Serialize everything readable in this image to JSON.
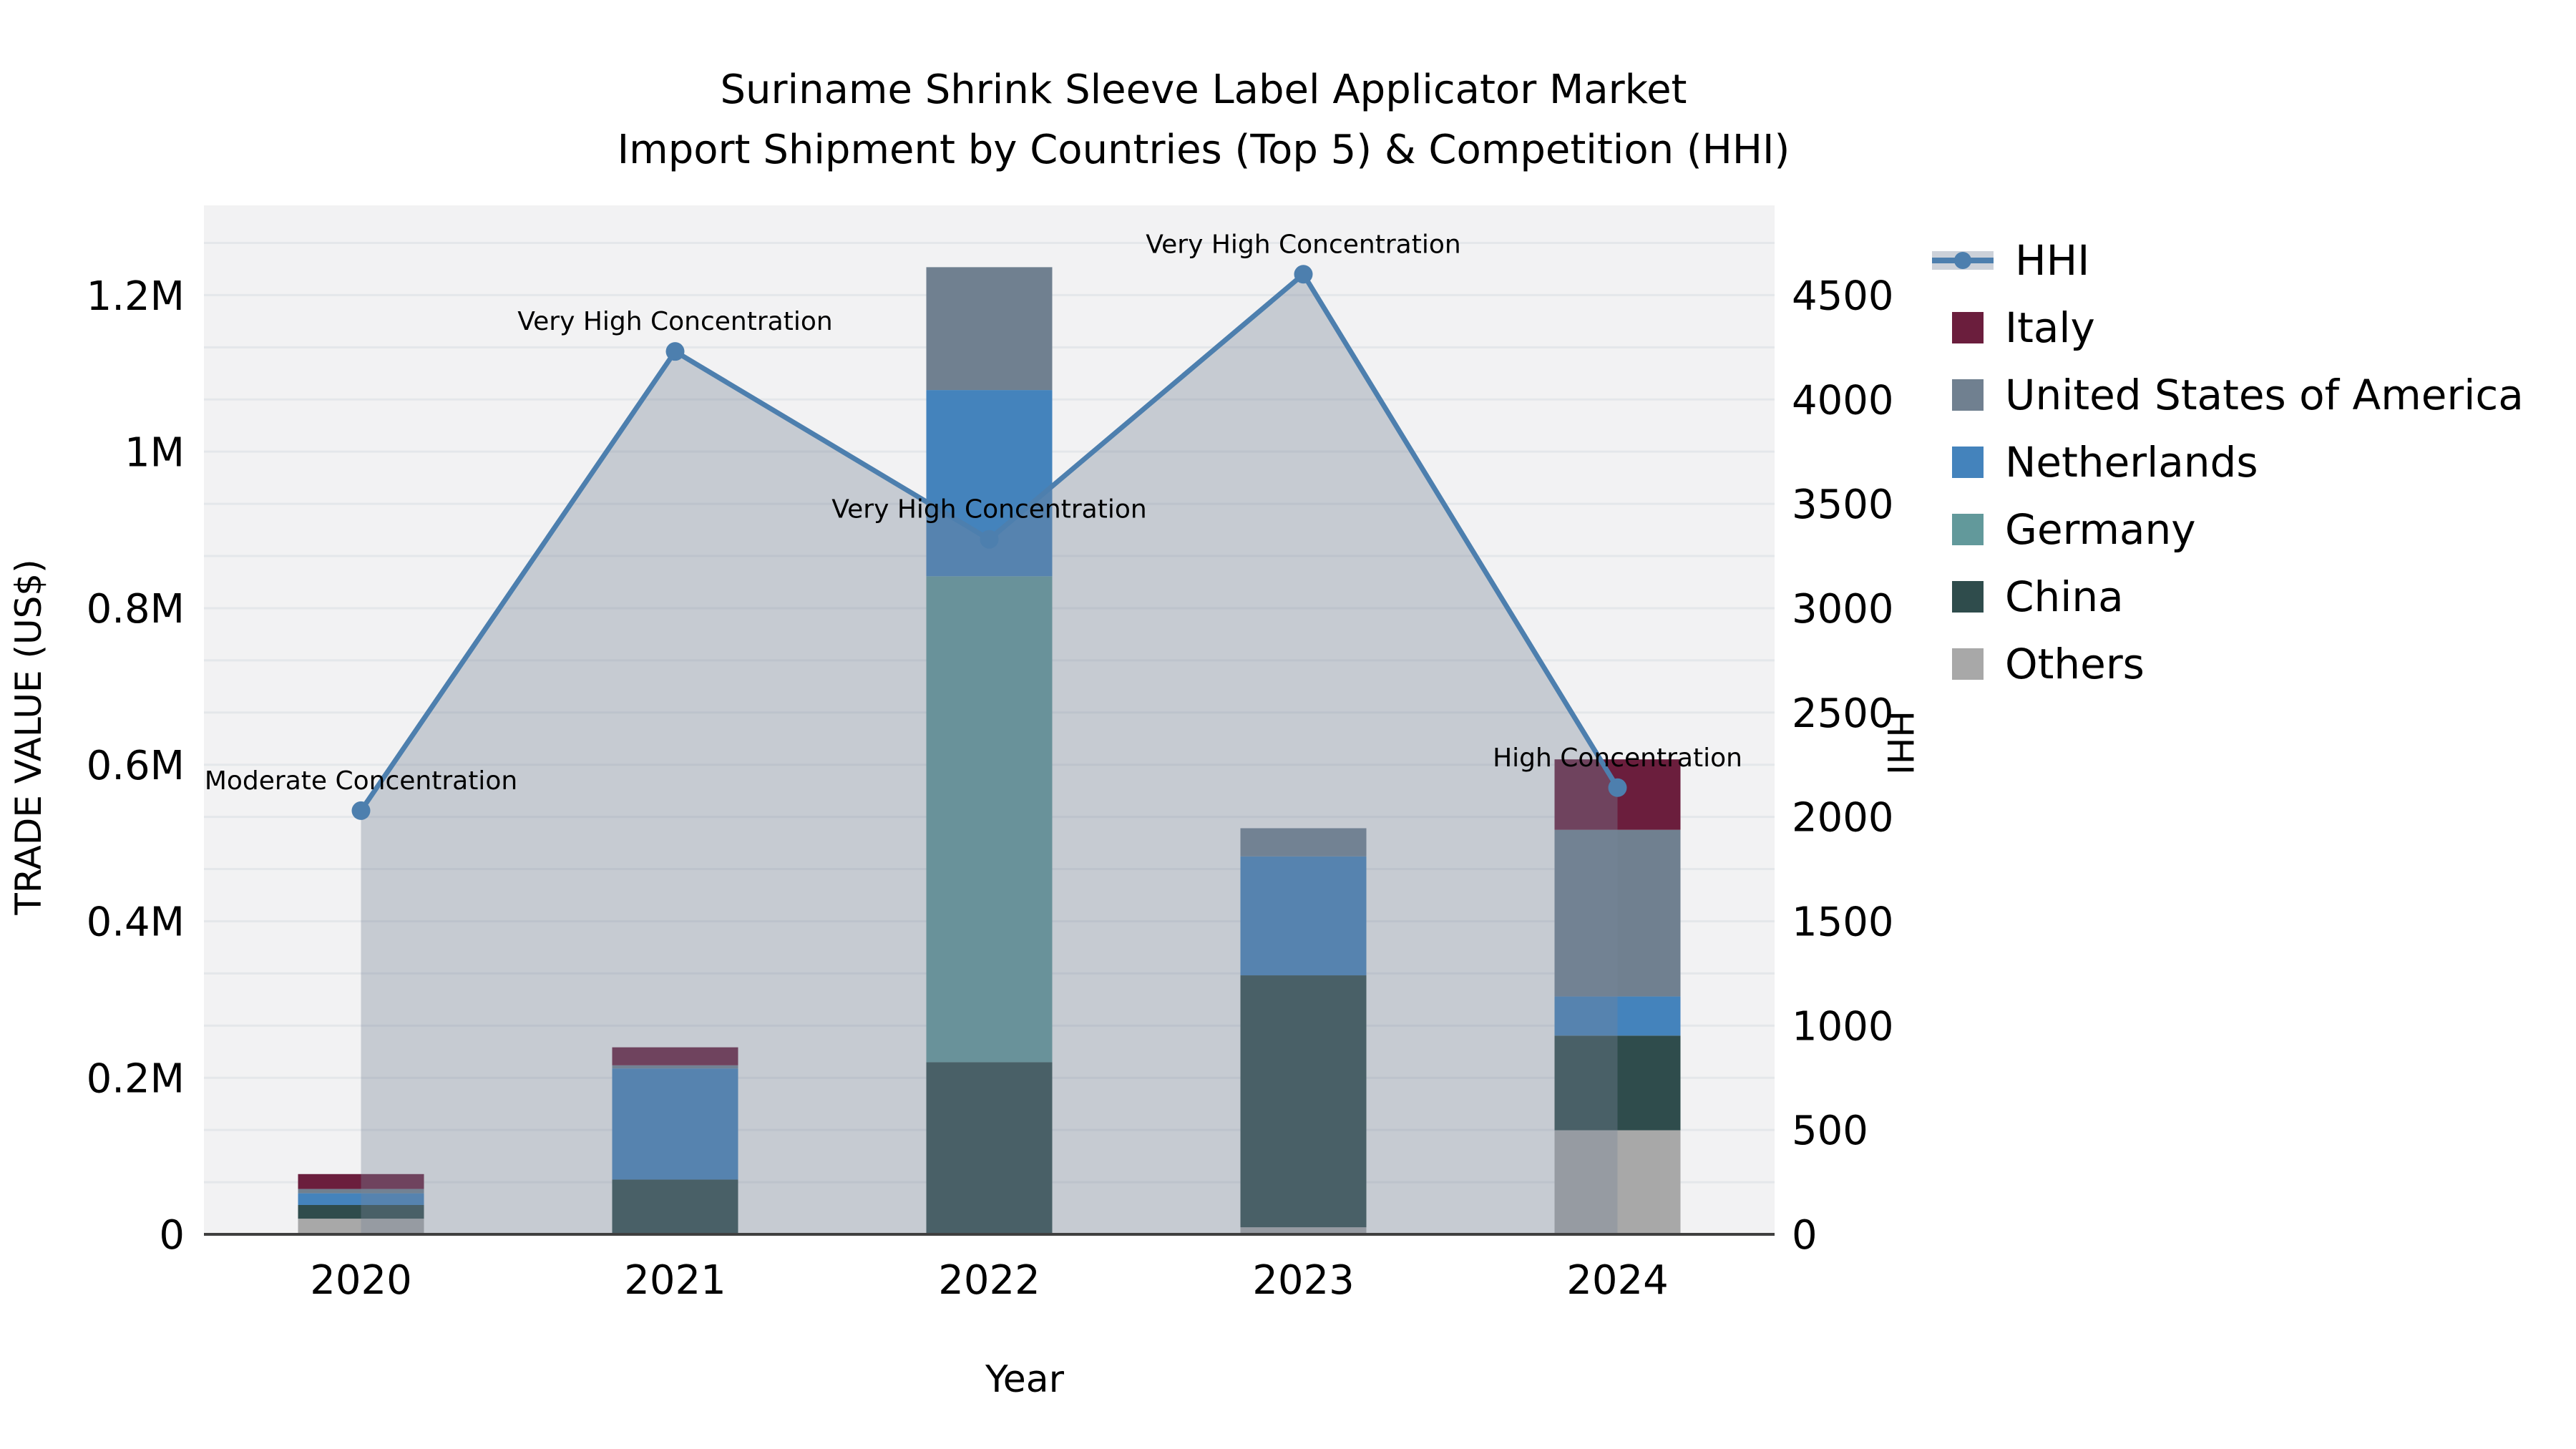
{
  "title": {
    "line1": "Suriname Shrink Sleeve Label Applicator Market",
    "line2": "Import Shipment by Countries (Top 5) & Competition (HHI)"
  },
  "chart_data": {
    "type": "bar",
    "subtype": "stacked-bars-with-line-overlay",
    "categories": [
      "2020",
      "2021",
      "2022",
      "2023",
      "2024"
    ],
    "series": [
      {
        "name": "Italy",
        "color": "#6b1e3d",
        "values": [
          19000,
          23000,
          0,
          0,
          90000
        ]
      },
      {
        "name": "United States of America",
        "color": "#708090",
        "values": [
          5500,
          4000,
          157000,
          36000,
          213000
        ]
      },
      {
        "name": "Netherlands",
        "color": "#4483bc",
        "values": [
          15000,
          142000,
          238000,
          152000,
          50000
        ]
      },
      {
        "name": "Germany",
        "color": "#62999b",
        "values": [
          0,
          0,
          621000,
          0,
          0
        ]
      },
      {
        "name": "China",
        "color": "#2f4c4c",
        "values": [
          17500,
          70000,
          220000,
          322000,
          121000
        ]
      },
      {
        "name": "Others",
        "color": "#a8a8a8",
        "values": [
          20000,
          0,
          0,
          9000,
          133000
        ]
      }
    ],
    "hhi": {
      "name": "HHI",
      "color": "#4d7fae",
      "area_fill": "rgba(118,132,152,0.36)",
      "values": [
        2030,
        4230,
        3330,
        4600,
        2140
      ]
    },
    "annotations": [
      "Moderate Concentration",
      "Very High Concentration",
      "Very High Concentration",
      "Very High Concentration",
      "High Concentration"
    ],
    "axes": {
      "x": {
        "label": "Year"
      },
      "left": {
        "label": "TRADE VALUE (US$)",
        "max": 1315000,
        "ticks": [
          {
            "value": 0,
            "label": "0"
          },
          {
            "value": 200000,
            "label": "0.2M"
          },
          {
            "value": 400000,
            "label": "0.4M"
          },
          {
            "value": 600000,
            "label": "0.6M"
          },
          {
            "value": 800000,
            "label": "0.8M"
          },
          {
            "value": 1000000,
            "label": "1M"
          },
          {
            "value": 1200000,
            "label": "1.2M"
          }
        ]
      },
      "right": {
        "label": "HHI",
        "max": 4930,
        "grid_step": 250,
        "ticks": [
          {
            "value": 0,
            "label": "0"
          },
          {
            "value": 500,
            "label": "500"
          },
          {
            "value": 1000,
            "label": "1000"
          },
          {
            "value": 1500,
            "label": "1500"
          },
          {
            "value": 2000,
            "label": "2000"
          },
          {
            "value": 2500,
            "label": "2500"
          },
          {
            "value": 3000,
            "label": "3000"
          },
          {
            "value": 3500,
            "label": "3500"
          },
          {
            "value": 4000,
            "label": "4000"
          },
          {
            "value": 4500,
            "label": "4500"
          }
        ]
      }
    },
    "legend_position": "right",
    "grid": "on",
    "plot_bg": "#f2f2f3",
    "grid_color": "#e4e7ea",
    "axis_line_color": "#3f3f3f"
  }
}
